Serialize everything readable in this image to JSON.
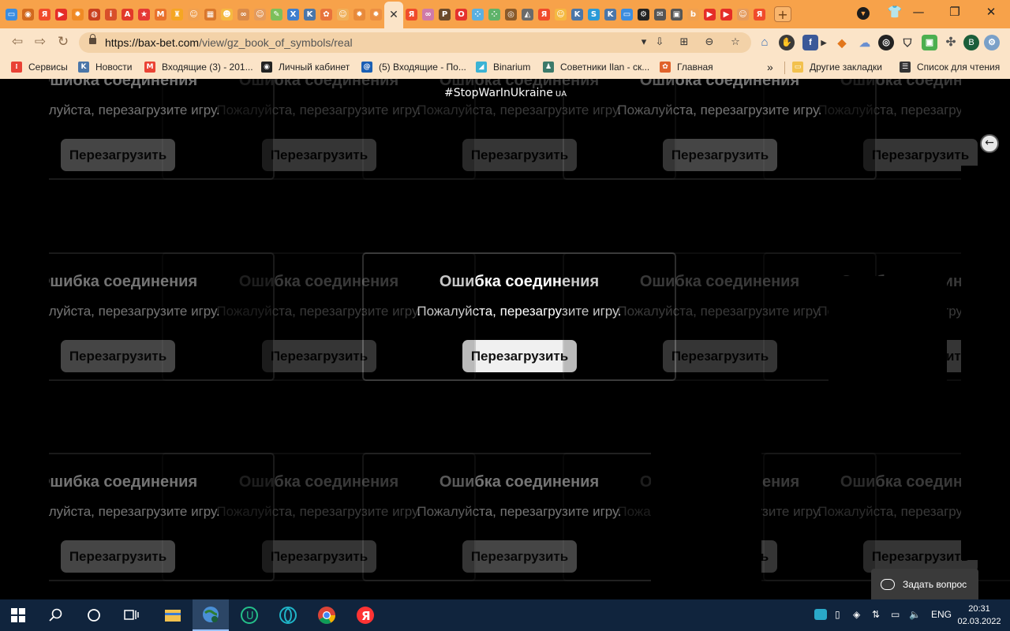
{
  "browser": {
    "active_tab_close": "✕",
    "new_tab": "+",
    "window_controls": {
      "minimize": "—",
      "maximize": "❐",
      "close": "✕"
    },
    "url": {
      "host": "https://bax-bet.com",
      "path": "/view/gz_book_of_symbols/real"
    },
    "profile_initial": "B"
  },
  "tabs": [
    {
      "icon": "chat-icon",
      "color": "#3b8de0",
      "glyph": "▭"
    },
    {
      "icon": "games-icon",
      "color": "#d2691e",
      "glyph": "◉"
    },
    {
      "icon": "yandex-icon",
      "color": "#f04b2b",
      "glyph": "Я"
    },
    {
      "icon": "youtube-icon",
      "color": "#e52d27",
      "glyph": "▶"
    },
    {
      "icon": "sun-icon",
      "color": "#f08a24",
      "glyph": "✹"
    },
    {
      "icon": "lotto-icon",
      "color": "#c9401f",
      "glyph": "◍"
    },
    {
      "icon": "info-icon",
      "color": "#d84f2a",
      "glyph": "i"
    },
    {
      "icon": "letter-a-icon",
      "color": "#e23a2a",
      "glyph": "A"
    },
    {
      "icon": "star-icon",
      "color": "#e53935",
      "glyph": "★"
    },
    {
      "icon": "gmail-icon",
      "color": "#e8712c",
      "glyph": "M"
    },
    {
      "icon": "trophy-icon",
      "color": "#f5a623",
      "glyph": "♜"
    },
    {
      "icon": "bear-icon",
      "color": "#f0a050",
      "glyph": "☺"
    },
    {
      "icon": "shop-icon",
      "color": "#d9772c",
      "glyph": "▦"
    },
    {
      "icon": "face-icon",
      "color": "#f5b942",
      "glyph": "☻"
    },
    {
      "icon": "infinity-icon",
      "color": "#d98a4a",
      "glyph": "∞"
    },
    {
      "icon": "mask-icon",
      "color": "#e59b5c",
      "glyph": "☺"
    },
    {
      "icon": "pen-icon",
      "color": "#7cbf5b",
      "glyph": "✎"
    },
    {
      "icon": "excel-icon",
      "color": "#3e7fce",
      "glyph": "X"
    },
    {
      "icon": "vk-icon",
      "color": "#4a76a8",
      "glyph": "K"
    },
    {
      "icon": "flower-icon",
      "color": "#e8733c",
      "glyph": "✿"
    },
    {
      "icon": "face2-icon",
      "color": "#f0b05a",
      "glyph": "☺"
    },
    {
      "icon": "sun2-icon",
      "color": "#e88a3a",
      "glyph": "✹"
    },
    {
      "icon": "sun3-icon",
      "color": "#ec8f42",
      "glyph": "✹"
    },
    {
      "icon": "yandex2-icon",
      "color": "#f04b2b",
      "glyph": "Я"
    },
    {
      "icon": "infinity2-icon",
      "color": "#cf7aa8",
      "glyph": "∞"
    },
    {
      "icon": "parking-icon",
      "color": "#6b4a2a",
      "glyph": "P"
    },
    {
      "icon": "opera-icon",
      "color": "#e5322d",
      "glyph": "O"
    },
    {
      "icon": "grid-icon",
      "color": "#5bb0e0",
      "glyph": "⁘"
    },
    {
      "icon": "grid2-icon",
      "color": "#5fb36a",
      "glyph": "⁘"
    },
    {
      "icon": "medal-icon",
      "color": "#8a5a2a",
      "glyph": "◎"
    },
    {
      "icon": "profile-icon",
      "color": "#6a6a6a",
      "glyph": "◭"
    },
    {
      "icon": "yandex3-icon",
      "color": "#f04b2b",
      "glyph": "Я"
    },
    {
      "icon": "smile-icon",
      "color": "#f5b942",
      "glyph": "☺"
    },
    {
      "icon": "vk2-icon",
      "color": "#4a76a8",
      "glyph": "K"
    },
    {
      "icon": "skype-icon",
      "color": "#2a9ad8",
      "glyph": "S"
    },
    {
      "icon": "vk3-icon",
      "color": "#4a76a8",
      "glyph": "K"
    },
    {
      "icon": "message-icon",
      "color": "#3b8de0",
      "glyph": "▭"
    },
    {
      "icon": "gear-icon",
      "color": "#222222",
      "glyph": "⚙"
    },
    {
      "icon": "mail-icon",
      "color": "#555555",
      "glyph": "✉"
    },
    {
      "icon": "archive-icon",
      "color": "#555555",
      "glyph": "▣"
    },
    {
      "icon": "b-icon",
      "color": "#f0a050",
      "glyph": "b"
    },
    {
      "icon": "youtube2-icon",
      "color": "#e52d27",
      "glyph": "▶"
    },
    {
      "icon": "youtube3-icon",
      "color": "#e52d27",
      "glyph": "▶"
    },
    {
      "icon": "mask2-icon",
      "color": "#e59b5c",
      "glyph": "☺"
    },
    {
      "icon": "yandex4-icon",
      "color": "#f04b2b",
      "glyph": "Я"
    }
  ],
  "bookmarks": [
    {
      "name": "bookmark-services",
      "label": "Сервисы",
      "icon": "apps-grid-icon",
      "color": "#e94235",
      "glyph": "⁞"
    },
    {
      "name": "bookmark-news",
      "label": "Новости",
      "icon": "vk-icon",
      "color": "#4a76a8",
      "glyph": "K"
    },
    {
      "name": "bookmark-inbox",
      "label": "Входящие (3) - 201...",
      "icon": "gmail-icon",
      "color": "#ea4335",
      "glyph": "M"
    },
    {
      "name": "bookmark-cabinet",
      "label": "Личный кабинет",
      "icon": "globe-icon",
      "color": "#222222",
      "glyph": "◉"
    },
    {
      "name": "bookmark-inbox2",
      "label": "(5) Входящие - По...",
      "icon": "at-sign-icon",
      "color": "#1a5fb4",
      "glyph": "@"
    },
    {
      "name": "bookmark-binarium",
      "label": "Binarium",
      "icon": "binarium-icon",
      "color": "#3bb3d4",
      "glyph": "◢"
    },
    {
      "name": "bookmark-advisors",
      "label": "Советники Ilan - ск...",
      "icon": "figure-icon",
      "color": "#3c7a6a",
      "glyph": "♟"
    },
    {
      "name": "bookmark-home",
      "label": "Главная",
      "icon": "flower-icon",
      "color": "#e0622a",
      "glyph": "✿"
    },
    {
      "name": "bookmark-other",
      "label": "Другие закладки",
      "icon": "folder-icon",
      "color": "#f2c14e",
      "glyph": "▭"
    },
    {
      "name": "bookmark-reading-list",
      "label": "Список для чтения",
      "icon": "reading-list-icon",
      "color": "#333333",
      "glyph": "☰"
    }
  ],
  "bookmarks_more": "»",
  "page": {
    "hashtag": "#StopWarInUkraine",
    "hashtag_suffix": "UA",
    "dialog_title": "Ошибка соединения",
    "dialog_message": "Пожалуйста, перезагрузите игру.",
    "dialog_button": "Перезагрузить",
    "ask_question": "Задать вопрос"
  },
  "taskbar": {
    "language": "ENG",
    "time": "20:31",
    "date": "02.03.2022"
  }
}
